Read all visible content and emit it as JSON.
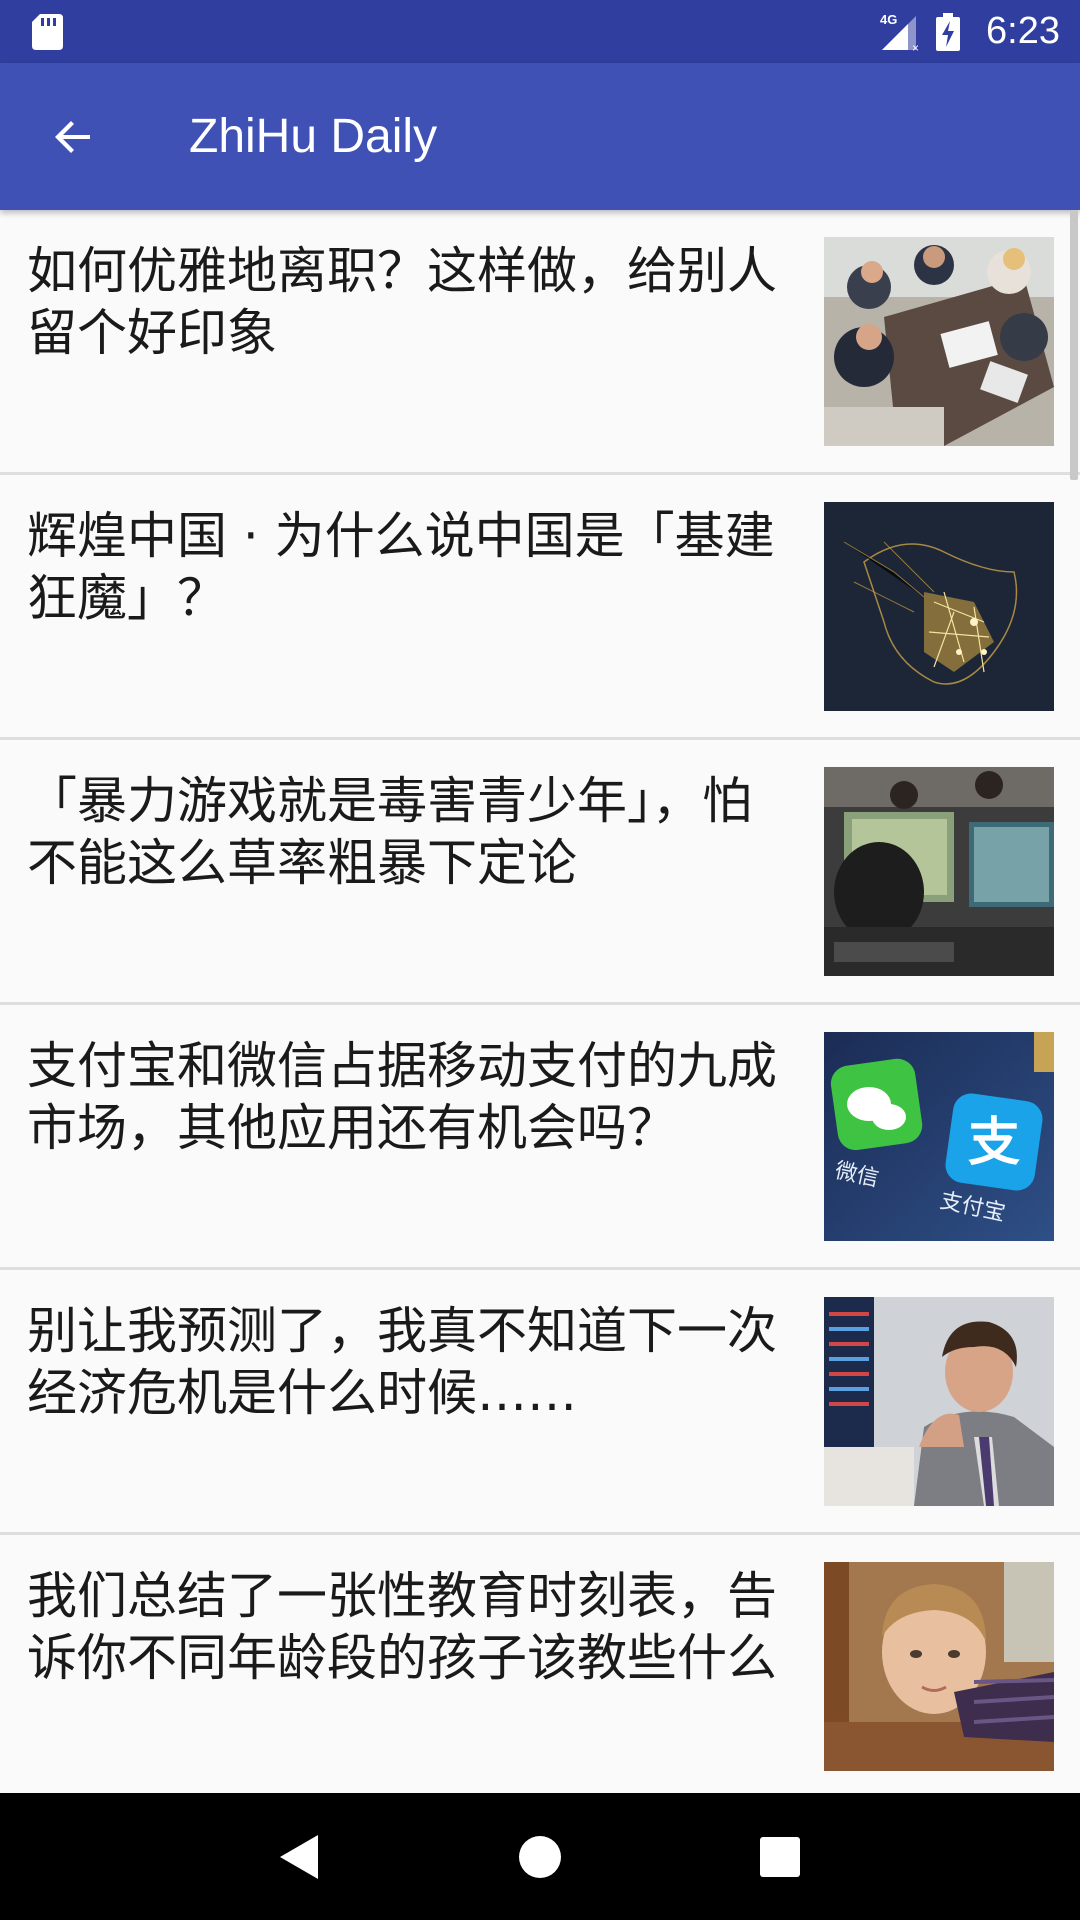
{
  "status_bar": {
    "network": "4G",
    "time": "6:23",
    "icons": [
      "sd-card-icon",
      "signal-icon",
      "battery-charging-icon"
    ]
  },
  "app_bar": {
    "title": "ZhiHu Daily",
    "back_icon": "arrow-back-icon"
  },
  "stories": [
    {
      "title": "如何优雅地离职？这样做，给别人留个好印象",
      "image": "business-meeting"
    },
    {
      "title": "辉煌中国 · 为什么说中国是「基建狂魔」？",
      "image": "china-night-map"
    },
    {
      "title": "「暴力游戏就是毒害青少年」，怕不能这么草率粗暴下定论",
      "image": "internet-cafe-gamers"
    },
    {
      "title": "支付宝和微信占据移动支付的九成市场，其他应用还有机会吗？",
      "image": "wechat-alipay-icons"
    },
    {
      "title": "别让我预测了，我真不知道下一次经济危机是什么时候……",
      "image": "man-in-suit"
    },
    {
      "title": "我们总结了一张性教育时刻表，告诉你不同年龄段的孩子该教些什么",
      "image": "boy-portrait"
    }
  ],
  "thumb_labels": {
    "wechat": "微信",
    "alipay": "支付宝"
  },
  "nav_bar": {
    "buttons": [
      "back-triangle-icon",
      "home-circle-icon",
      "recents-square-icon"
    ]
  },
  "colors": {
    "status_bar": "#303f9f",
    "app_bar": "#3f51b5",
    "background": "#fafafa",
    "divider": "#dedede"
  }
}
